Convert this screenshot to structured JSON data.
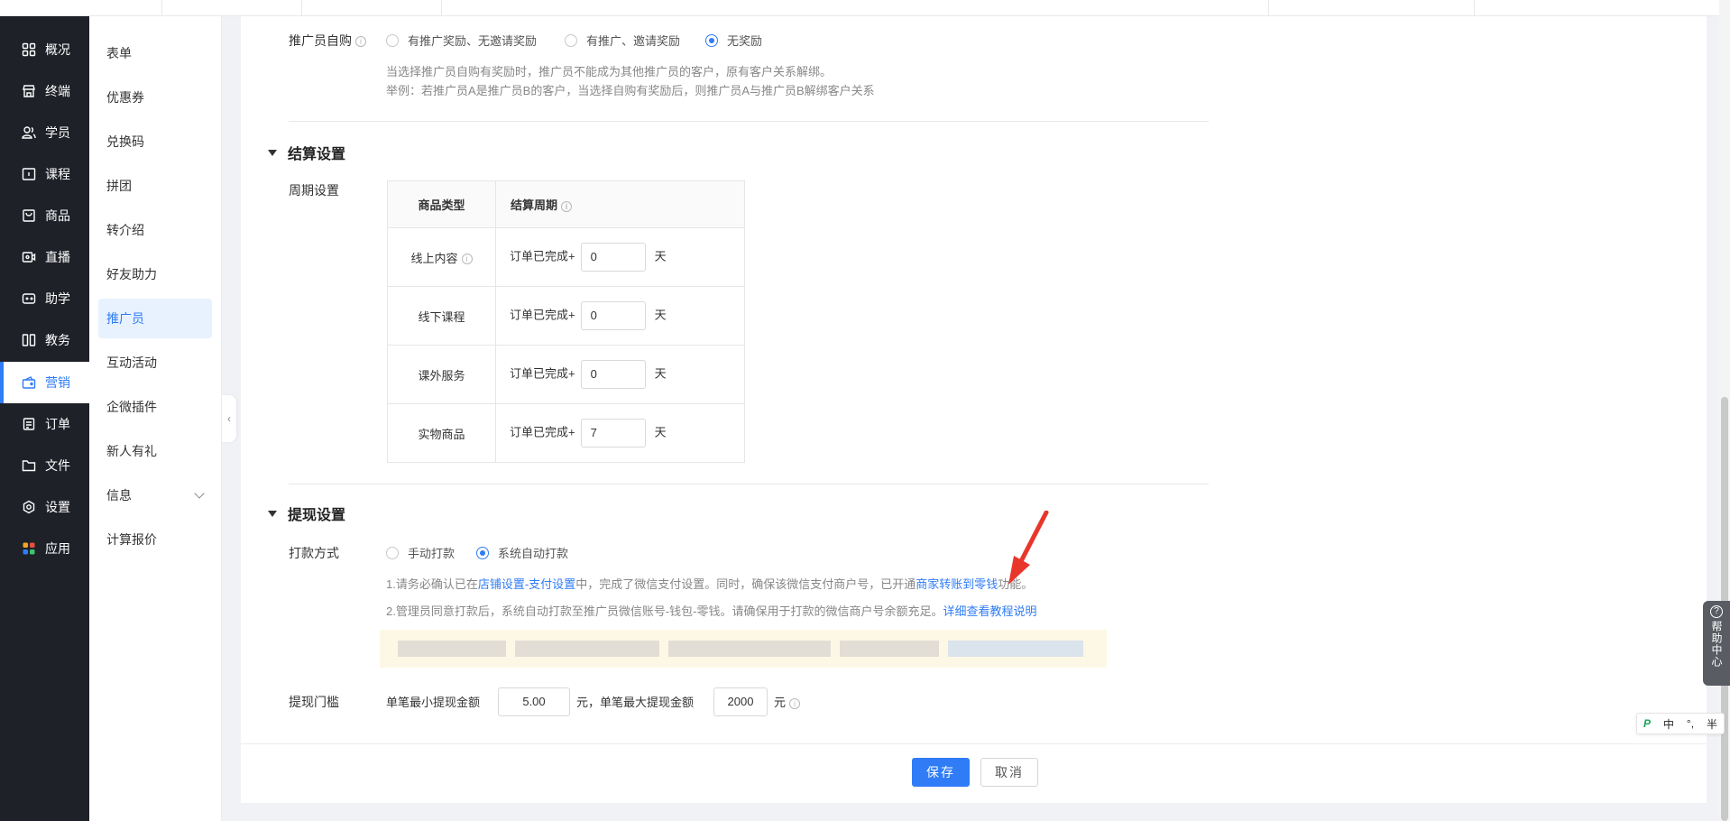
{
  "topbar": {},
  "nav": {
    "items": [
      {
        "label": "概况",
        "icon": "grid-icon"
      },
      {
        "label": "终端",
        "icon": "store-icon"
      },
      {
        "label": "学员",
        "icon": "users-icon"
      },
      {
        "label": "课程",
        "icon": "course-icon"
      },
      {
        "label": "商品",
        "icon": "bag-icon"
      },
      {
        "label": "直播",
        "icon": "live-icon"
      },
      {
        "label": "助学",
        "icon": "gamepad-icon"
      },
      {
        "label": "教务",
        "icon": "book-icon"
      },
      {
        "label": "营销",
        "icon": "marketing-icon"
      },
      {
        "label": "订单",
        "icon": "order-icon"
      },
      {
        "label": "文件",
        "icon": "folder-icon"
      },
      {
        "label": "设置",
        "icon": "gear-icon"
      },
      {
        "label": "应用",
        "icon": "apps-icon"
      }
    ],
    "active": "营销",
    "active_color": "#2f7cf6"
  },
  "subnav": {
    "items": [
      {
        "label": "表单"
      },
      {
        "label": "优惠券"
      },
      {
        "label": "兑换码"
      },
      {
        "label": "拼团"
      },
      {
        "label": "转介绍"
      },
      {
        "label": "好友助力"
      },
      {
        "label": "推广员"
      },
      {
        "label": "互动活动"
      },
      {
        "label": "企微插件"
      },
      {
        "label": "新人有礼"
      },
      {
        "label": "信息"
      },
      {
        "label": "计算报价"
      }
    ],
    "active": "推广员"
  },
  "self_purchase": {
    "label": "推广员自购",
    "options": [
      "有推广奖励、无邀请奖励",
      "有推广、邀请奖励",
      "无奖励"
    ],
    "selected": "无奖励",
    "note_line1": "当选择推广员自购有奖励时，推广员不能成为其他推广员的客户，原有客户关系解绑。",
    "note_line2": "举例：若推广员A是推广员B的客户，当选择自购有奖励后，则推广员A与推广员B解绑客户关系"
  },
  "settlement": {
    "title": "结算设置",
    "period_label": "周期设置",
    "col_type": "商品类型",
    "col_period": "结算周期",
    "prefix": "订单已完成+",
    "unit": "天",
    "rows": [
      {
        "type": "线上内容",
        "days": "0",
        "has_info": true
      },
      {
        "type": "线下课程",
        "days": "0",
        "has_info": false
      },
      {
        "type": "课外服务",
        "days": "0",
        "has_info": false
      },
      {
        "type": "实物商品",
        "days": "7",
        "has_info": false
      }
    ]
  },
  "withdraw": {
    "title": "提现设置",
    "method_label": "打款方式",
    "options": [
      "手动打款",
      "系统自动打款"
    ],
    "selected": "系统自动打款",
    "note1_a": "1.请务必确认已在",
    "note1_link1": "店铺设置-支付设置",
    "note1_b": "中，完成了微信支付设置。同时，确保该微信支付商户号，已开通",
    "note1_link2": "商家转账到零钱",
    "note1_c": "功能。",
    "note2_a": "2.管理员同意打款后，系统自动打款至推广员微信账号-钱包-零钱。请确保用于打款的微信商户号余额充足。",
    "note2_link": "详细查看教程说明",
    "threshold_label": "提现门槛",
    "min_label": "单笔最小提现金额",
    "min_value": "5.00",
    "unit": "元",
    "max_label": "，单笔最大提现金额",
    "max_value": "2000",
    "max_unit": "元"
  },
  "footer": {
    "save_label": "保存",
    "cancel_label": "取消"
  },
  "help": {
    "label": "帮助中心"
  },
  "ime": {
    "lang": "中",
    "punct": "°,",
    "width": "半"
  }
}
